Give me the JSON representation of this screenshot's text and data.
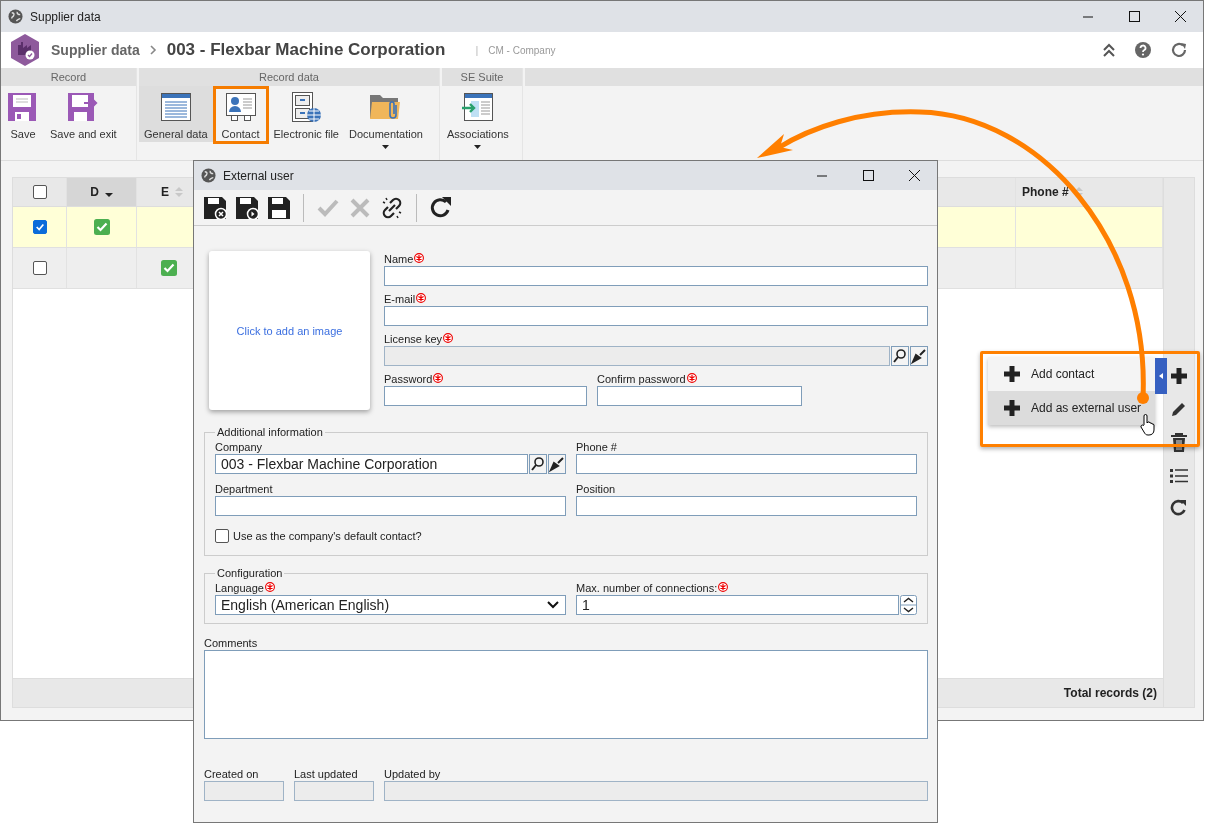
{
  "window": {
    "title": "Supplier data"
  },
  "header": {
    "breadcrumb": "Supplier data",
    "title": "003 - Flexbar Machine Corporation",
    "divider": "|",
    "subtitle": "CM - Company"
  },
  "ribbon": [
    {
      "label": "Record",
      "buttons": [
        {
          "label": "Save",
          "selected": false,
          "highlighted": false,
          "dropdown": false
        },
        {
          "label": "Save and exit",
          "selected": false,
          "highlighted": false,
          "dropdown": false
        }
      ]
    },
    {
      "label": "Record data",
      "buttons": [
        {
          "label": "General data",
          "selected": true,
          "highlighted": false,
          "dropdown": false
        },
        {
          "label": "Contact",
          "selected": false,
          "highlighted": true,
          "dropdown": false
        },
        {
          "label": "Electronic file",
          "selected": false,
          "highlighted": false,
          "dropdown": false
        },
        {
          "label": "Documentation",
          "selected": false,
          "highlighted": false,
          "dropdown": true
        }
      ]
    },
    {
      "label": "SE Suite",
      "buttons": [
        {
          "label": "Associations",
          "selected": false,
          "highlighted": false,
          "dropdown": true
        }
      ]
    }
  ],
  "grid": {
    "columns": [
      {
        "kind": "select",
        "checked": false
      },
      {
        "kind": "text",
        "label": "D",
        "sorted": true
      },
      {
        "kind": "text",
        "label": "E",
        "sorted": false
      },
      {
        "kind": "text",
        "label": "Phone #",
        "sorted": false
      }
    ],
    "rows": [
      {
        "selected": true,
        "d": true,
        "e": false
      },
      {
        "selected": false,
        "d": false,
        "e": true
      }
    ],
    "footer": "Total records (2)"
  },
  "menu": {
    "items": [
      {
        "label": "Add contact",
        "hovered": false
      },
      {
        "label": "Add as external user",
        "hovered": true
      }
    ]
  },
  "dialog": {
    "title": "External user",
    "toolbar": [
      {
        "buttons": [
          {
            "disabled": false
          },
          {
            "disabled": false
          },
          {
            "disabled": false
          }
        ]
      },
      {
        "buttons": [
          {
            "disabled": true
          },
          {
            "disabled": true
          },
          {
            "disabled": false
          }
        ]
      },
      {
        "buttons": [
          {
            "disabled": false
          }
        ]
      }
    ],
    "image_placeholder": "Click to add an image",
    "name": {
      "label": "Name",
      "required": true,
      "disabled": false
    },
    "email": {
      "label": "E-mail",
      "required": true,
      "disabled": false
    },
    "license_key": {
      "label": "License key",
      "required": true,
      "disabled": true
    },
    "password": {
      "label": "Password",
      "required": true
    },
    "confirm_password": {
      "label": "Confirm password",
      "required": true
    },
    "additional": {
      "legend": "Additional information",
      "company": {
        "label": "Company",
        "value": "003 - Flexbar Machine Corporation"
      },
      "phone": {
        "label": "Phone #"
      },
      "department": {
        "label": "Department"
      },
      "position": {
        "label": "Position"
      },
      "default_contact": {
        "label": "Use as the company's default contact?",
        "checked": false
      }
    },
    "configuration": {
      "legend": "Configuration",
      "language": {
        "label": "Language",
        "required": true,
        "value": "English (American English)"
      },
      "max_connections": {
        "label": "Max. number of connections:",
        "required": true,
        "value": "1"
      }
    },
    "comments": {
      "label": "Comments"
    },
    "audit": [
      {
        "label": "Created on",
        "disabled": true
      },
      {
        "label": "Last updated",
        "disabled": true
      },
      {
        "label": "Updated by",
        "disabled": true
      }
    ]
  }
}
